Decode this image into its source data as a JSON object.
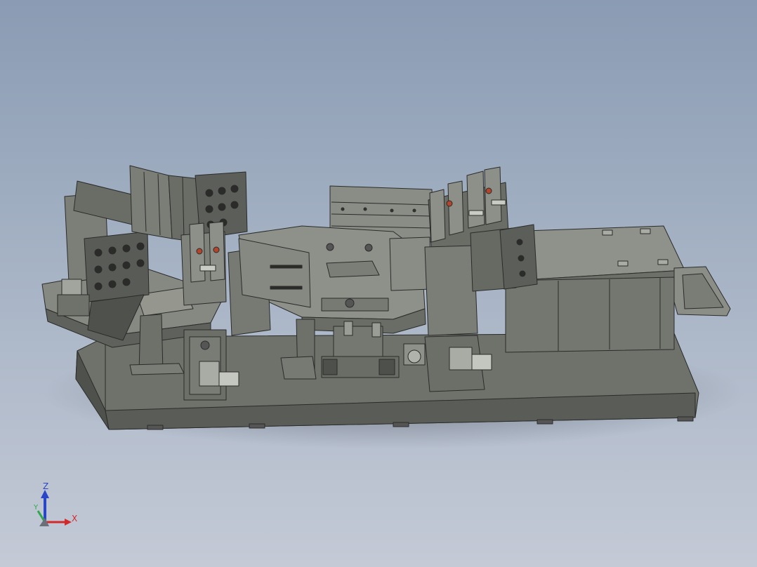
{
  "triad": {
    "z_label": "Z",
    "y_label": "Y",
    "x_label": "X",
    "z_color": "#2a46c8",
    "y_color": "#2ea84a",
    "x_color": "#d22a2a"
  },
  "colors": {
    "background_top": "#8a9bb3",
    "background_bottom": "#c4cad6",
    "metal_dark": "#5e605a",
    "metal_mid": "#7b7d77",
    "metal_light": "#9a9c96",
    "edge": "#2b2c2a",
    "accent_red": "#b4442a"
  },
  "model": {
    "name_icon": "cad-assembly-welding-fixture"
  }
}
